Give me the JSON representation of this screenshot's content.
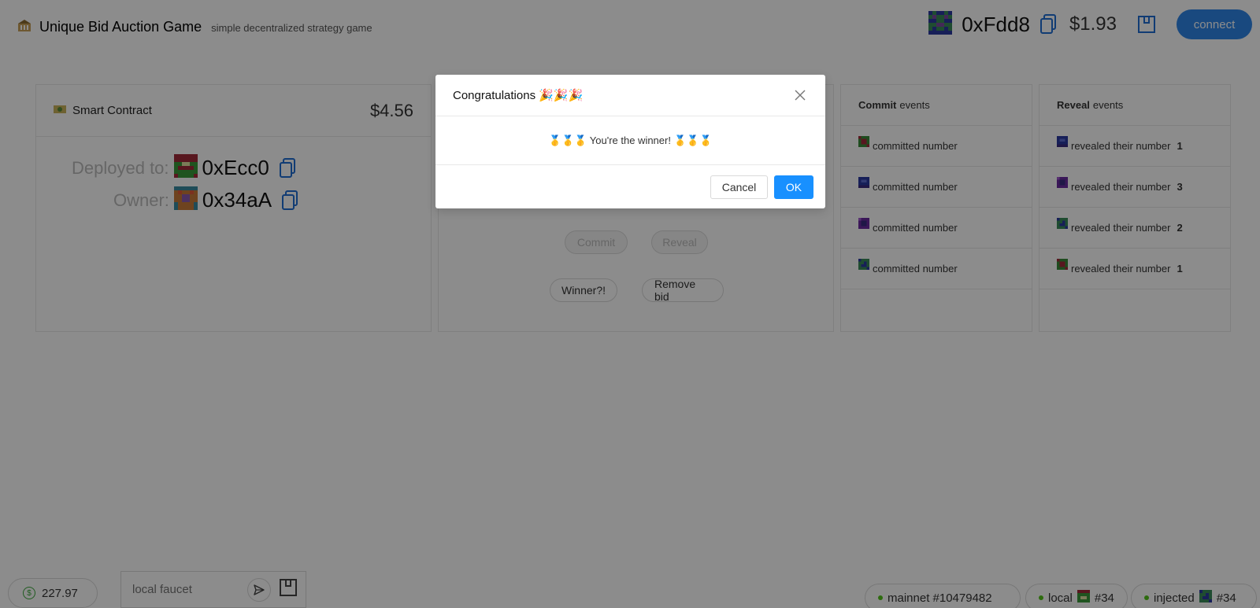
{
  "header": {
    "brand_icon": "bank-icon",
    "title": "Unique Bid Auction Game",
    "subtitle": "simple decentralized strategy game",
    "account_address": "0xFdd8",
    "account_balance": "$1.93",
    "connect_label": "connect"
  },
  "contract": {
    "title": "Smart Contract",
    "icon": "money-icon",
    "balance": "$4.56",
    "deployed_label": "Deployed to:",
    "deployed_address": "0xEcc0",
    "owner_label": "Owner:",
    "owner_address": "0x34aA"
  },
  "actions": {
    "commit": "Commit",
    "reveal": "Reveal",
    "winner": "Winner?!",
    "remove_bid": "Remove bid"
  },
  "commit_events": {
    "title_bold": "Commit",
    "title_rest": "events",
    "rows": [
      {
        "text": "committed number"
      },
      {
        "text": "committed number"
      },
      {
        "text": "committed number"
      },
      {
        "text": "committed number"
      }
    ]
  },
  "reveal_events": {
    "title_bold": "Reveal",
    "title_rest": "events",
    "rows": [
      {
        "text": "revealed their number",
        "number": "1"
      },
      {
        "text": "revealed their number",
        "number": "3"
      },
      {
        "text": "revealed their number",
        "number": "2"
      },
      {
        "text": "revealed their number",
        "number": "1"
      }
    ]
  },
  "footer": {
    "wallet_balance": "227.97",
    "faucet_placeholder": "local faucet",
    "networks": [
      {
        "label": "mainnet #10479482"
      },
      {
        "label": "local",
        "suffix": "#34"
      },
      {
        "label": "injected",
        "suffix": "#34"
      }
    ]
  },
  "modal": {
    "title": "Congratulations 🎉🎉🎉",
    "message": "🥇🥇🥇  You're the winner! 🥇🥇🥇",
    "cancel_label": "Cancel",
    "ok_label": "OK"
  },
  "colors": {
    "primary": "#1890ff",
    "connect": "#2f86e8",
    "status_dot": "#52c41a"
  }
}
